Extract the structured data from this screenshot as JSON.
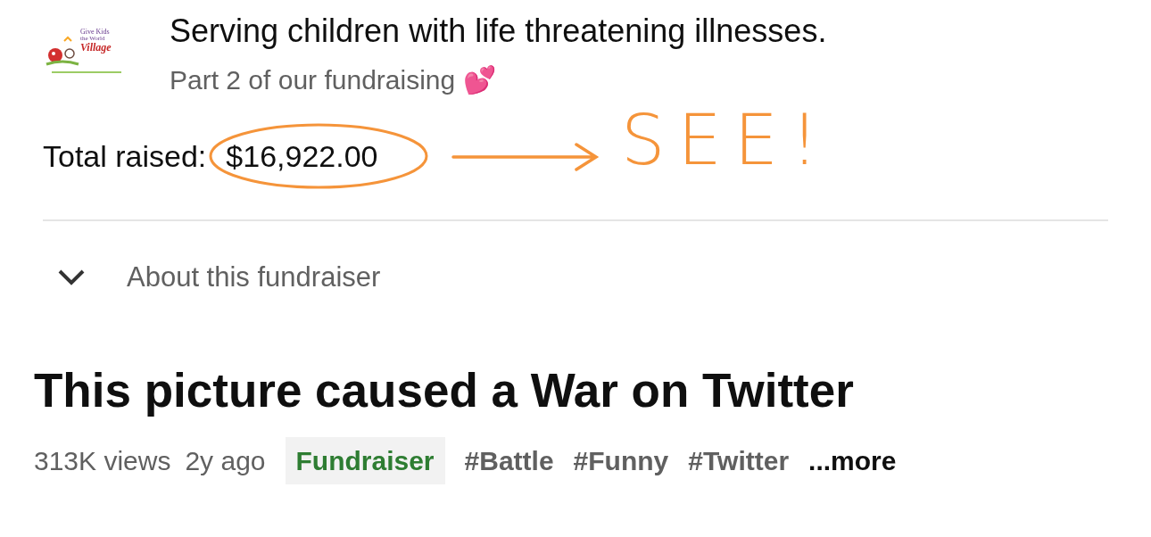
{
  "fundraiser": {
    "logo": {
      "line_1": "Give Kids",
      "line_2": "the World",
      "line_3": "Village"
    },
    "title": "Serving children with life threatening illnesses.",
    "subtitle": "Part 2 of our fundraising 💕",
    "total_label": "Total raised:",
    "total_amount": "$16,922.00",
    "annotation": "SEE!",
    "about": {
      "label": "About this fundraiser",
      "expanded": false
    }
  },
  "video": {
    "title": "This picture caused a War on Twitter",
    "views": "313K views",
    "age": "2y ago",
    "tags": [
      {
        "text": "Fundraiser",
        "kind": "badge"
      },
      {
        "text": "#Battle",
        "kind": "hashtag"
      },
      {
        "text": "#Funny",
        "kind": "hashtag"
      },
      {
        "text": "#Twitter",
        "kind": "hashtag"
      }
    ],
    "more": "...more"
  }
}
